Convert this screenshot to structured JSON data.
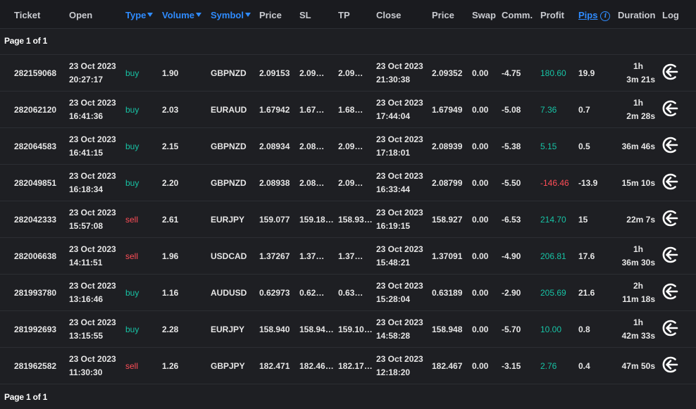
{
  "columns": {
    "ticket": "Ticket",
    "open": "Open",
    "type": "Type",
    "volume": "Volume",
    "symbol": "Symbol",
    "price_open": "Price",
    "sl": "SL",
    "tp": "TP",
    "close": "Close",
    "price_close": "Price",
    "swap": "Swap",
    "comm": "Comm.",
    "profit": "Profit",
    "pips": "Pips",
    "duration": "Duration",
    "log": "Log"
  },
  "pager": {
    "label": "Page 1 of 1"
  },
  "colors": {
    "accent": "#2f8cff",
    "buy": "#17c3a5",
    "sell": "#ff4d57",
    "background": "#1e1f23"
  },
  "rows": [
    {
      "ticket": "282159068",
      "open_date": "23 Oct 2023",
      "open_time": "20:27:17",
      "type": "buy",
      "volume": "1.90",
      "symbol": "GBPNZD",
      "price_open": "2.09153",
      "sl": "2.09…",
      "tp": "2.09…",
      "close_date": "23 Oct 2023",
      "close_time": "21:30:38",
      "price_close": "2.09352",
      "swap": "0.00",
      "comm": "-4.75",
      "profit": "180.60",
      "pips": "19.9",
      "dur1": "1h",
      "dur2": "3m 21s"
    },
    {
      "ticket": "282062120",
      "open_date": "23 Oct 2023",
      "open_time": "16:41:36",
      "type": "buy",
      "volume": "2.03",
      "symbol": "EURAUD",
      "price_open": "1.67942",
      "sl": "1.67…",
      "tp": "1.68…",
      "close_date": "23 Oct 2023",
      "close_time": "17:44:04",
      "price_close": "1.67949",
      "swap": "0.00",
      "comm": "-5.08",
      "profit": "7.36",
      "pips": "0.7",
      "dur1": "1h",
      "dur2": "2m 28s"
    },
    {
      "ticket": "282064583",
      "open_date": "23 Oct 2023",
      "open_time": "16:41:15",
      "type": "buy",
      "volume": "2.15",
      "symbol": "GBPNZD",
      "price_open": "2.08934",
      "sl": "2.08…",
      "tp": "2.09…",
      "close_date": "23 Oct 2023",
      "close_time": "17:18:01",
      "price_close": "2.08939",
      "swap": "0.00",
      "comm": "-5.38",
      "profit": "5.15",
      "pips": "0.5",
      "dur1": "",
      "dur2": "36m 46s"
    },
    {
      "ticket": "282049851",
      "open_date": "23 Oct 2023",
      "open_time": "16:18:34",
      "type": "buy",
      "volume": "2.20",
      "symbol": "GBPNZD",
      "price_open": "2.08938",
      "sl": "2.08…",
      "tp": "2.09…",
      "close_date": "23 Oct 2023",
      "close_time": "16:33:44",
      "price_close": "2.08799",
      "swap": "0.00",
      "comm": "-5.50",
      "profit": "-146.46",
      "pips": "-13.9",
      "dur1": "",
      "dur2": "15m 10s"
    },
    {
      "ticket": "282042333",
      "open_date": "23 Oct 2023",
      "open_time": "15:57:08",
      "type": "sell",
      "volume": "2.61",
      "symbol": "EURJPY",
      "price_open": "159.077",
      "sl": "159.18…",
      "tp": "158.93…",
      "close_date": "23 Oct 2023",
      "close_time": "16:19:15",
      "price_close": "158.927",
      "swap": "0.00",
      "comm": "-6.53",
      "profit": "214.70",
      "pips": "15",
      "dur1": "",
      "dur2": "22m 7s"
    },
    {
      "ticket": "282006638",
      "open_date": "23 Oct 2023",
      "open_time": "14:11:51",
      "type": "sell",
      "volume": "1.96",
      "symbol": "USDCAD",
      "price_open": "1.37267",
      "sl": "1.37…",
      "tp": "1.37…",
      "close_date": "23 Oct 2023",
      "close_time": "15:48:21",
      "price_close": "1.37091",
      "swap": "0.00",
      "comm": "-4.90",
      "profit": "206.81",
      "pips": "17.6",
      "dur1": "1h",
      "dur2": "36m 30s"
    },
    {
      "ticket": "281993780",
      "open_date": "23 Oct 2023",
      "open_time": "13:16:46",
      "type": "buy",
      "volume": "1.16",
      "symbol": "AUDUSD",
      "price_open": "0.62973",
      "sl": "0.62…",
      "tp": "0.63…",
      "close_date": "23 Oct 2023",
      "close_time": "15:28:04",
      "price_close": "0.63189",
      "swap": "0.00",
      "comm": "-2.90",
      "profit": "205.69",
      "pips": "21.6",
      "dur1": "2h",
      "dur2": "11m 18s"
    },
    {
      "ticket": "281992693",
      "open_date": "23 Oct 2023",
      "open_time": "13:15:55",
      "type": "buy",
      "volume": "2.28",
      "symbol": "EURJPY",
      "price_open": "158.940",
      "sl": "158.94…",
      "tp": "159.10…",
      "close_date": "23 Oct 2023",
      "close_time": "14:58:28",
      "price_close": "158.948",
      "swap": "0.00",
      "comm": "-5.70",
      "profit": "10.00",
      "pips": "0.8",
      "dur1": "1h",
      "dur2": "42m 33s"
    },
    {
      "ticket": "281962582",
      "open_date": "23 Oct 2023",
      "open_time": "11:30:30",
      "type": "sell",
      "volume": "1.26",
      "symbol": "GBPJPY",
      "price_open": "182.471",
      "sl": "182.46…",
      "tp": "182.17…",
      "close_date": "23 Oct 2023",
      "close_time": "12:18:20",
      "price_close": "182.467",
      "swap": "0.00",
      "comm": "-3.15",
      "profit": "2.76",
      "pips": "0.4",
      "dur1": "",
      "dur2": "47m 50s"
    }
  ]
}
